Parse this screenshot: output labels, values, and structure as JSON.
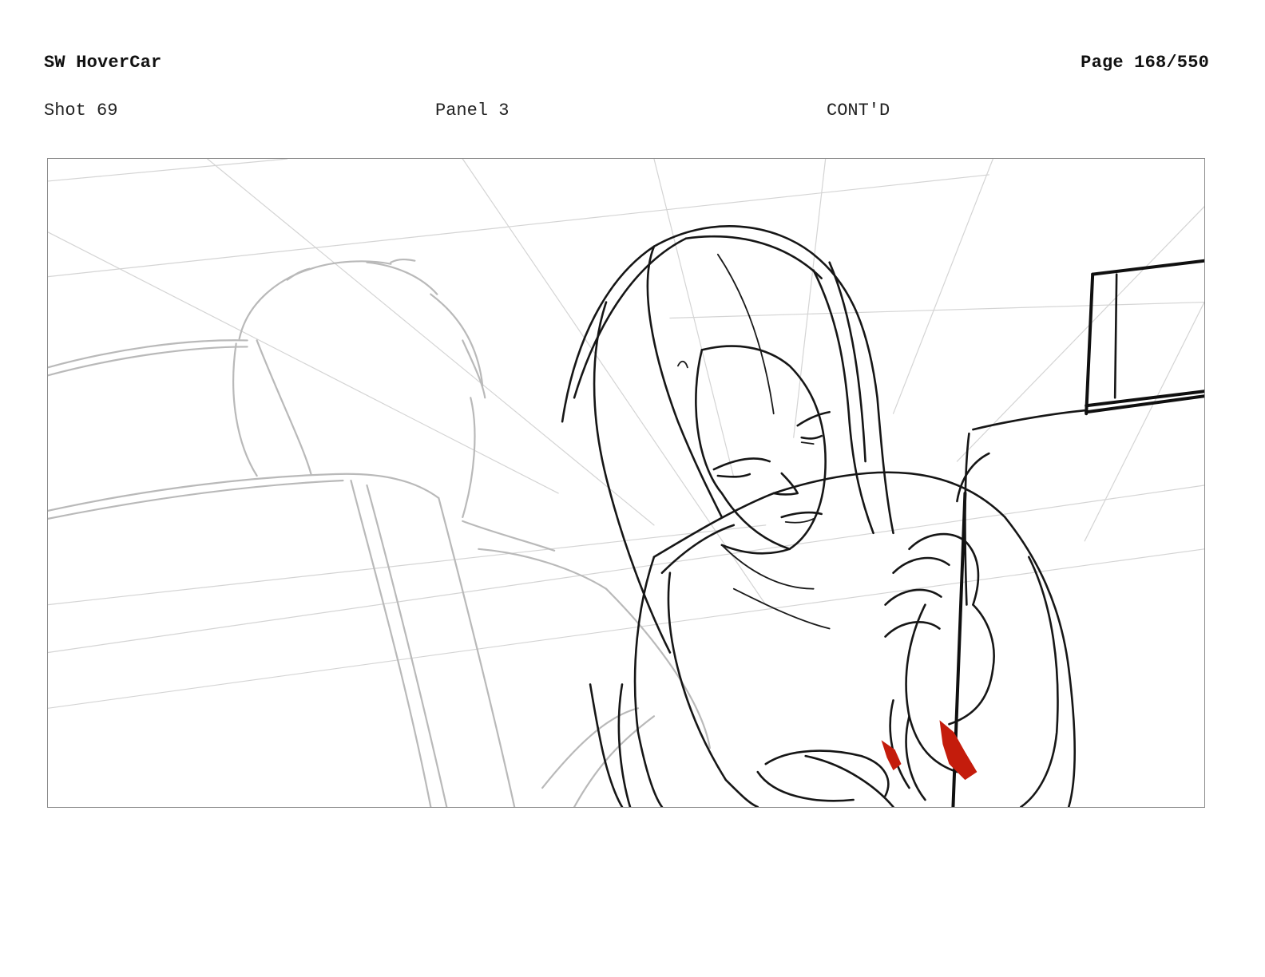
{
  "header": {
    "title": "SW HoverCar",
    "page_label": "Page 168/550"
  },
  "shot_info": {
    "shot": "Shot 69",
    "panel": "Panel 3",
    "continuation": "CONT'D"
  },
  "colors": {
    "ink": "#161616",
    "construction_lines": "#d4d4d4",
    "background_sketch": "#b9b9b9",
    "accent_red": "#c41c0c",
    "frame_border": "#8a8a8a"
  }
}
